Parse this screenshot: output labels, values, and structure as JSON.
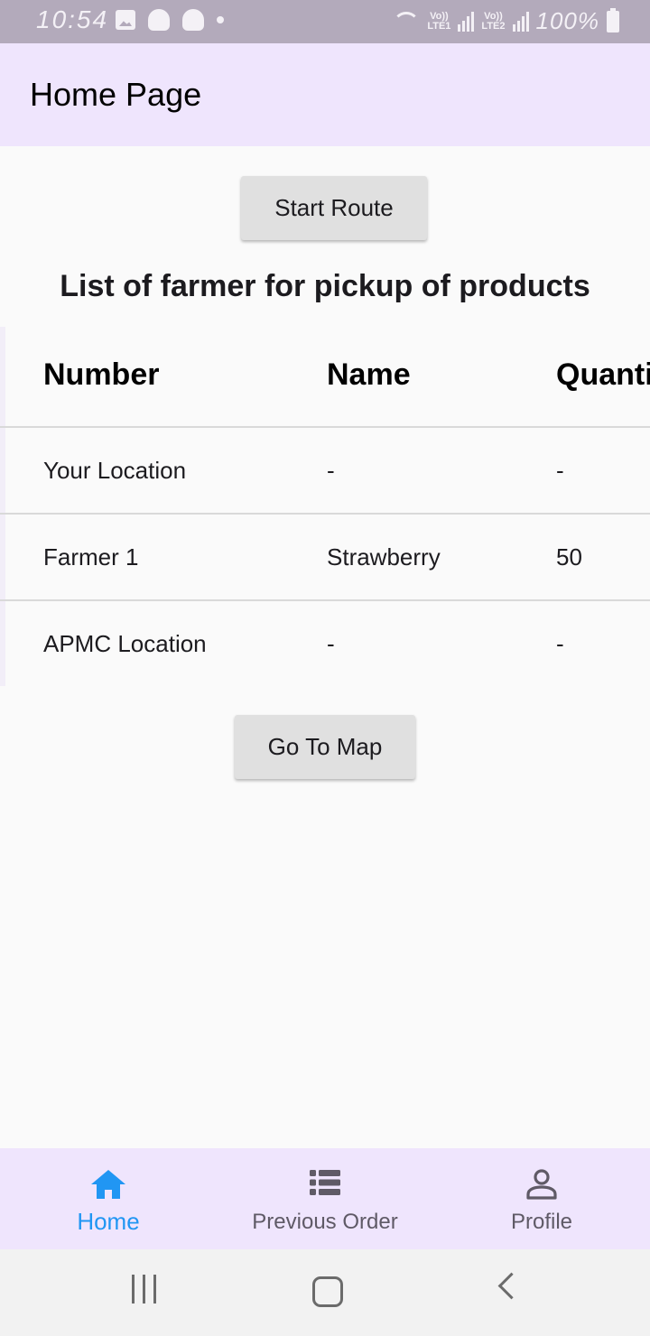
{
  "status_bar": {
    "time": "10:54",
    "lte1": "LTE1",
    "lte2": "LTE2",
    "volte": "Vo))",
    "battery": "100%"
  },
  "app_bar": {
    "title": "Home Page"
  },
  "main": {
    "start_route_label": "Start Route",
    "list_heading": "List of farmer for pickup of products",
    "table": {
      "headers": [
        "Number",
        "Name",
        "Quantity"
      ],
      "rows": [
        [
          "Your Location",
          "-",
          "-"
        ],
        [
          "Farmer 1",
          "Strawberry",
          "50"
        ],
        [
          "APMC Location",
          "-",
          "-"
        ]
      ]
    },
    "go_to_map_label": "Go To Map"
  },
  "bottom_nav": {
    "items": [
      {
        "label": "Home",
        "icon": "home-icon",
        "active": true
      },
      {
        "label": "Previous Order",
        "icon": "list-icon",
        "active": false
      },
      {
        "label": "Profile",
        "icon": "person-icon",
        "active": false
      }
    ],
    "active_color": "#2196f3",
    "inactive_color": "#5f5a66"
  },
  "colors": {
    "app_bar_bg": "#efe5fd",
    "status_bar_bg": "#b3aabb",
    "button_bg": "#e0e0e0"
  }
}
